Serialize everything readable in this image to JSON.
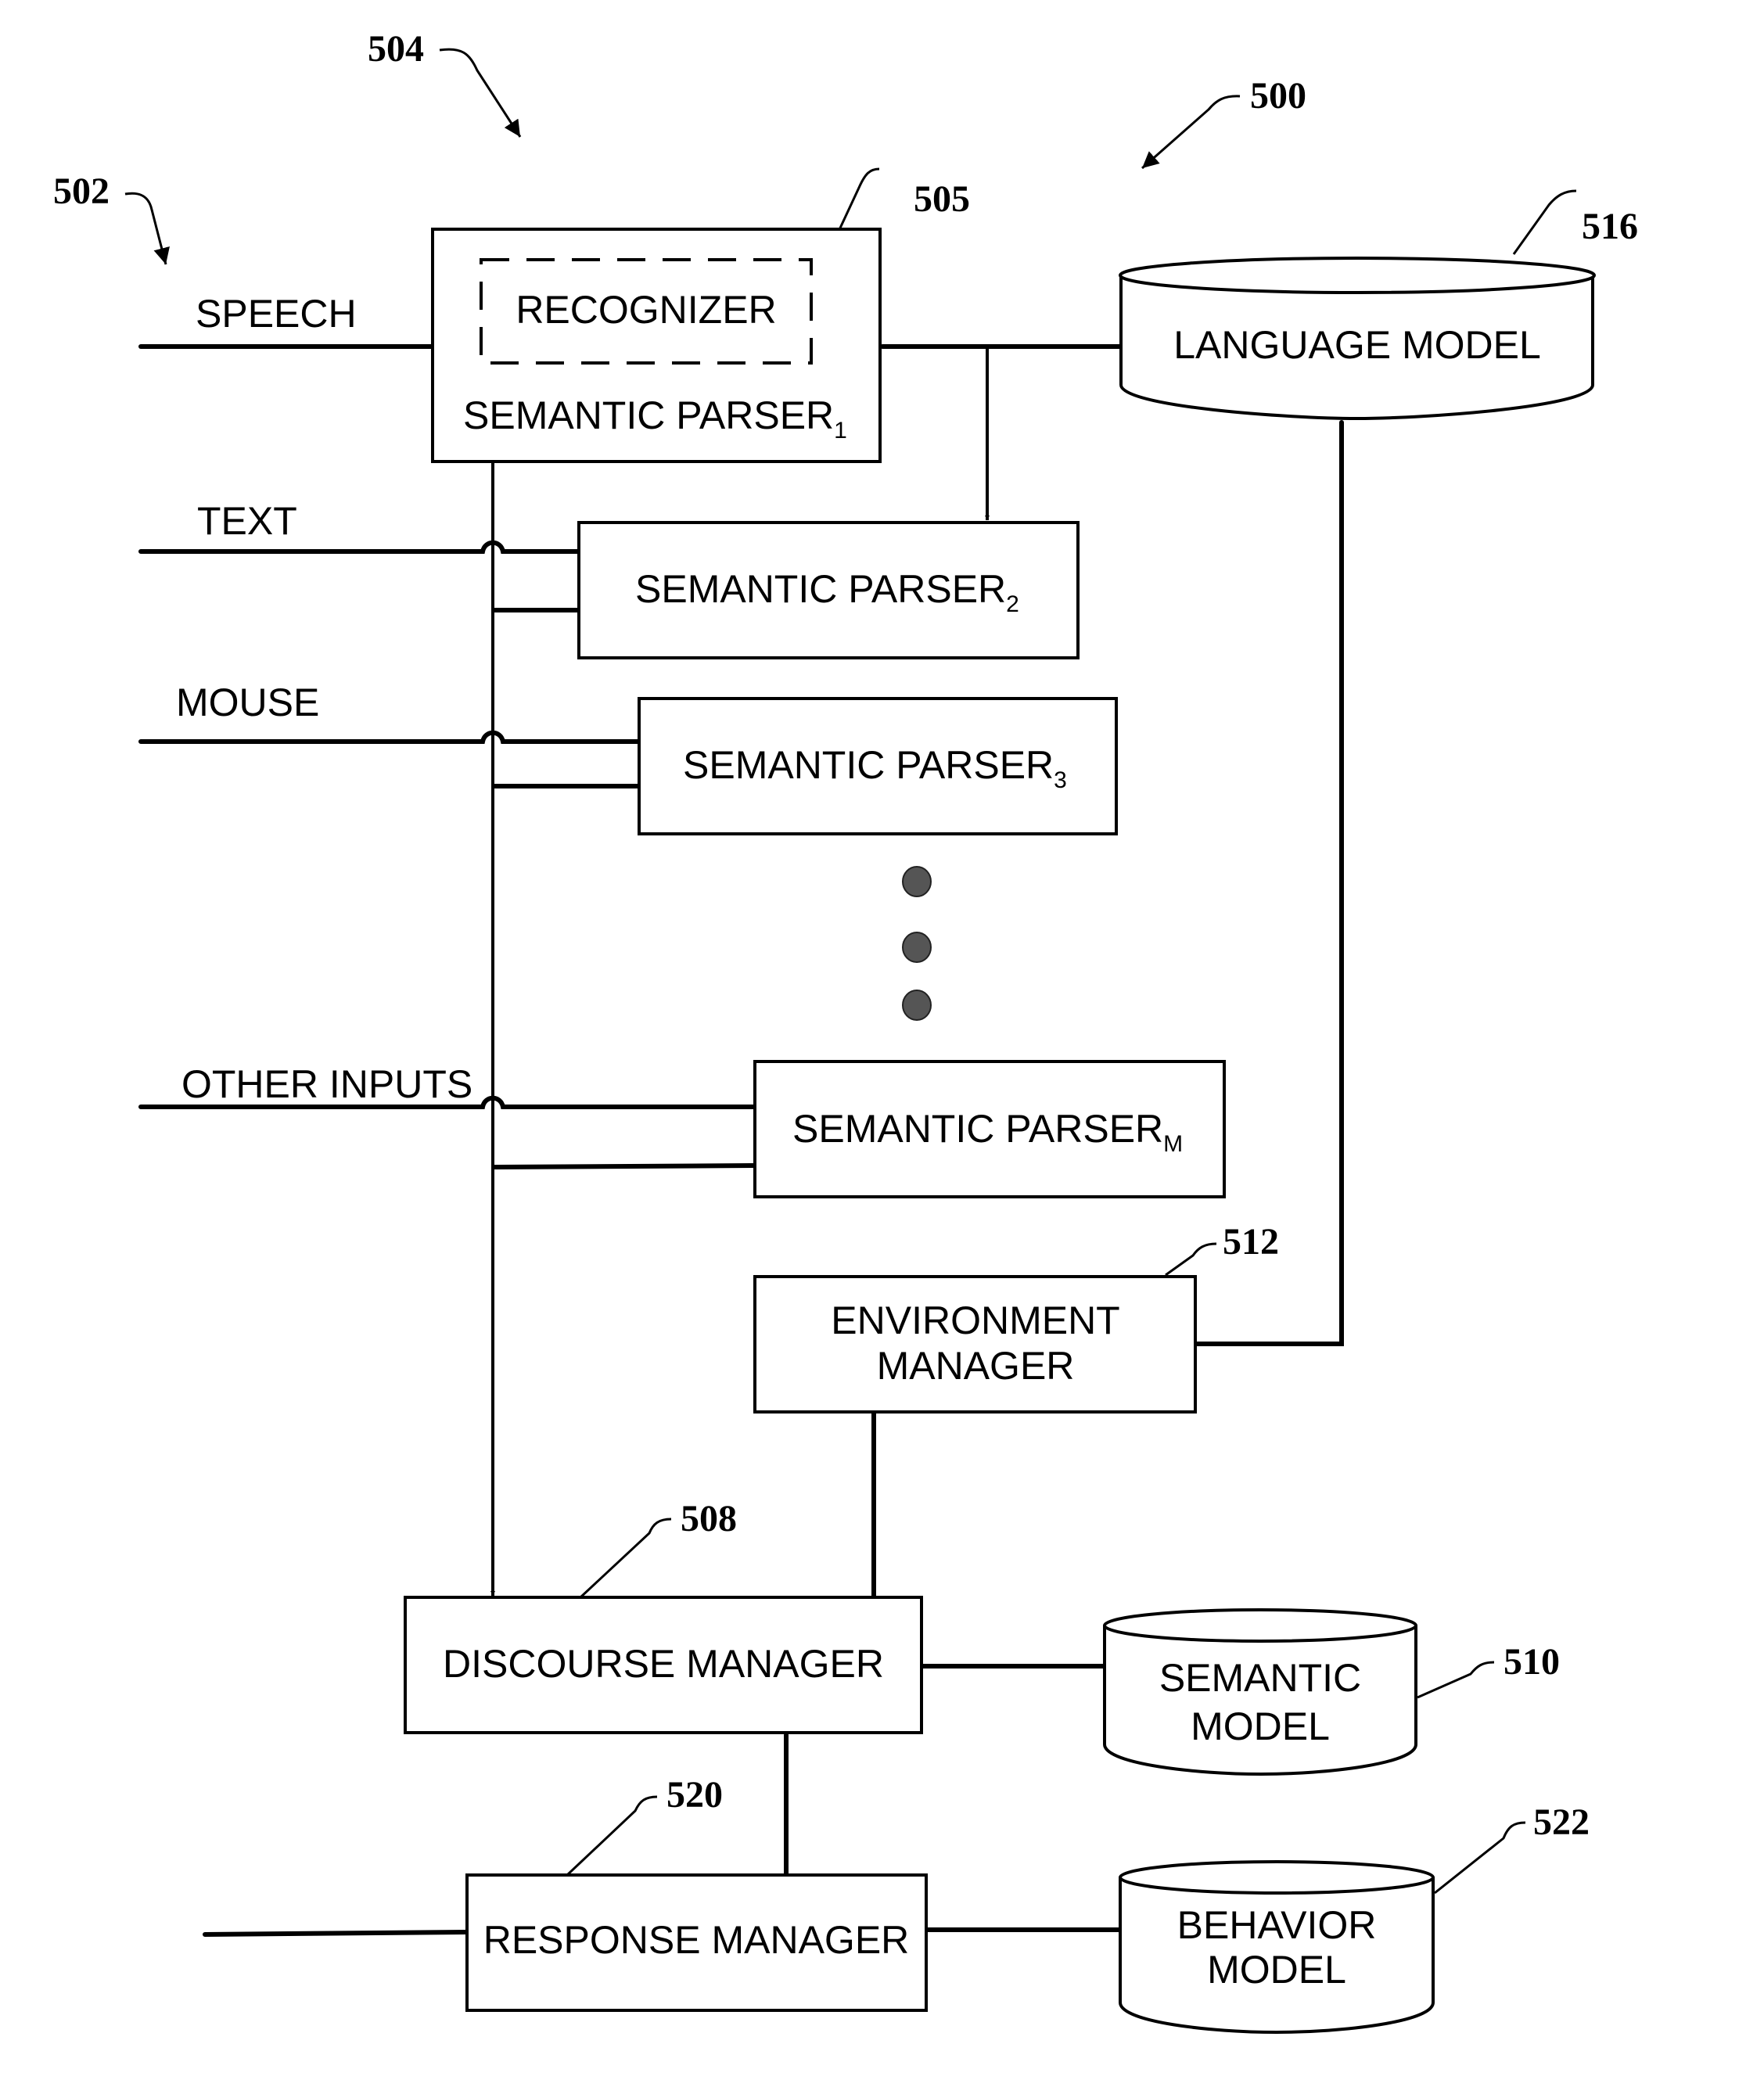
{
  "figure": {
    "ref_system": "500",
    "ref_inputs": "502",
    "ref_parsers": "504",
    "ref_recognizer": "505",
    "ref_discourse": "508",
    "ref_semantic_model": "510",
    "ref_environment": "512",
    "ref_language_model": "516",
    "ref_response": "520",
    "ref_behavior_model": "522"
  },
  "inputs": {
    "speech": "SPEECH",
    "text": "TEXT",
    "mouse": "MOUSE",
    "other": "OTHER INPUTS"
  },
  "blocks": {
    "recognizer": "RECOGNIZER",
    "parser1": {
      "label": "SEMANTIC PARSER",
      "sub": "1"
    },
    "parser2": {
      "label": "SEMANTIC PARSER",
      "sub": "2"
    },
    "parser3": {
      "label": "SEMANTIC PARSER",
      "sub": "3"
    },
    "parserM": {
      "label": "SEMANTIC PARSER",
      "sub": "M"
    },
    "environment_line1": "ENVIRONMENT",
    "environment_line2": "MANAGER",
    "discourse": "DISCOURSE MANAGER",
    "response": "RESPONSE MANAGER"
  },
  "stores": {
    "language_model": "LANGUAGE MODEL",
    "semantic_model_line1": "SEMANTIC",
    "semantic_model_line2": "MODEL",
    "behavior_model_line1": "BEHAVIOR",
    "behavior_model_line2": "MODEL"
  }
}
